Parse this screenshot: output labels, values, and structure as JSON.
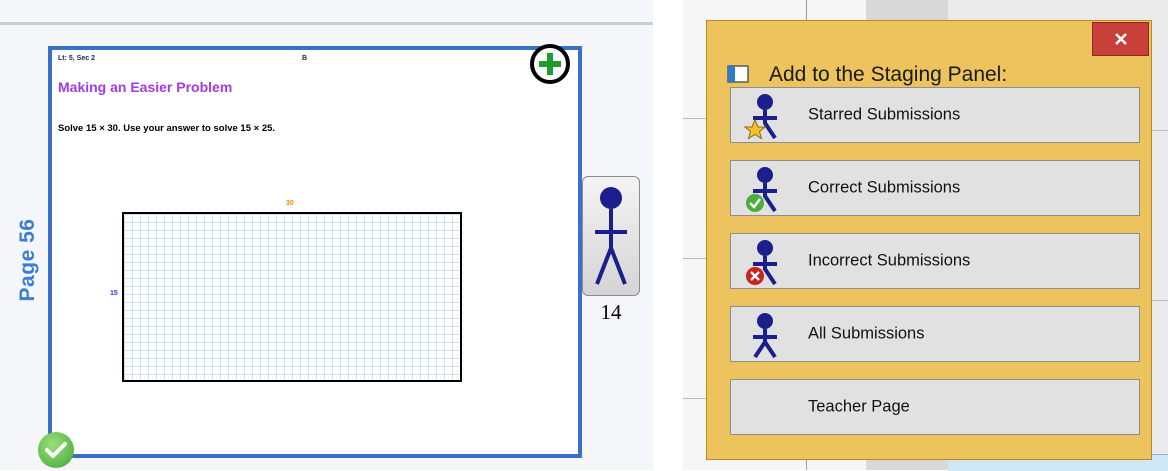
{
  "left": {
    "page_label": "Page 56",
    "page": {
      "header_left": "Lt: 5, Sec 2",
      "header_right": "B",
      "title": "Making an Easier Problem",
      "subtitle": "",
      "instruction": "Solve 15 × 30. Use your answer to solve 15 × 25.",
      "grid_top_label": "30",
      "grid_left_label": "15"
    },
    "student_count": "14"
  },
  "dialog": {
    "title": "Add to the Staging Panel:",
    "buttons": [
      {
        "label": "Starred Submissions",
        "icon": "starred-student-icon"
      },
      {
        "label": "Correct Submissions",
        "icon": "correct-student-icon"
      },
      {
        "label": "Incorrect Submissions",
        "icon": "incorrect-student-icon"
      },
      {
        "label": "All Submissions",
        "icon": "student-icon"
      },
      {
        "label": "Teacher Page",
        "icon": ""
      }
    ],
    "close_glyph": "✕"
  },
  "colors": {
    "page_border": "#3a70c8",
    "title_purple": "#a23be0",
    "dialog_bg": "#ecc35c",
    "close_red": "#c9403a",
    "student_blue": "#1a1f8c"
  }
}
